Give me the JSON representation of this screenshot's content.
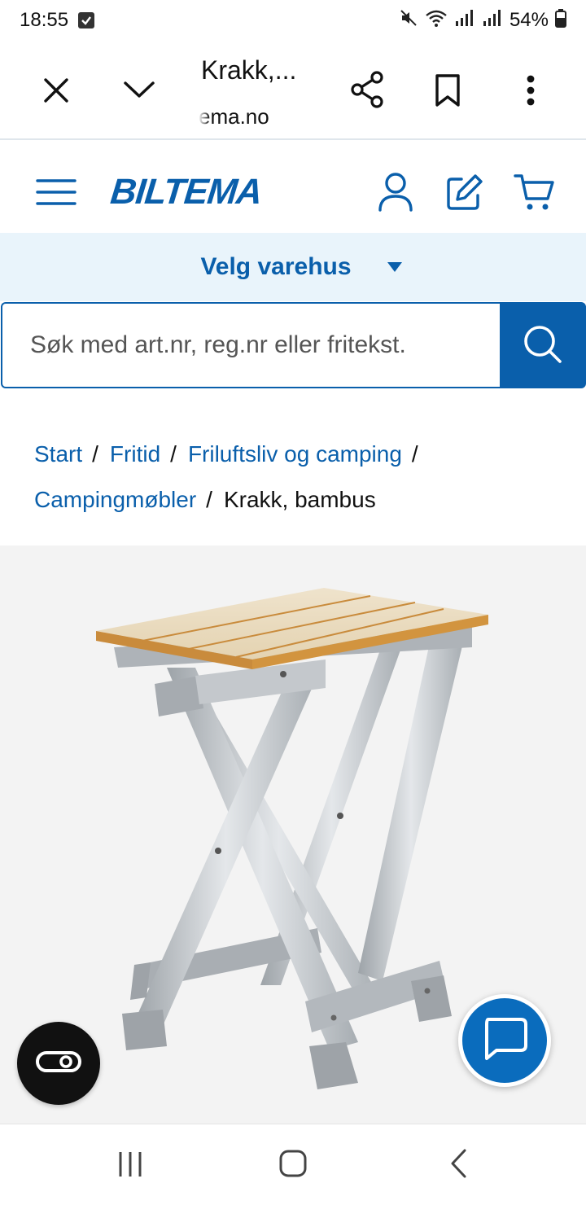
{
  "status_bar": {
    "time": "18:55",
    "battery": "54%"
  },
  "browser": {
    "tab_title": "Krakk,...",
    "url": "ema.no",
    "icons": [
      "close-icon",
      "chevron-down-icon",
      "share-icon",
      "bookmark-icon",
      "more-vert-icon"
    ]
  },
  "header": {
    "logo": "BILTEMA",
    "icons": [
      "menu-icon",
      "user-icon",
      "edit-icon",
      "cart-icon"
    ]
  },
  "store": {
    "label": "Velg varehus"
  },
  "search": {
    "placeholder": "Søk med art.nr, reg.nr eller fritekst.",
    "value": ""
  },
  "breadcrumb": {
    "items": [
      "Start",
      "Fritid",
      "Friluftsliv og camping",
      "Campingmøbler"
    ],
    "current": "Krakk, bambus",
    "separator": "/"
  },
  "product": {
    "image_icon": "folding-stool-image"
  },
  "floating": {
    "left_icon": "accessibility-toggle-icon",
    "right_icon": "chat-icon"
  },
  "nav": {
    "icons": [
      "recents-icon",
      "home-icon",
      "back-icon"
    ]
  },
  "colors": {
    "brand": "#0a5fab",
    "store_bar_bg": "#e9f4fb",
    "product_bg": "#f3f3f3"
  }
}
